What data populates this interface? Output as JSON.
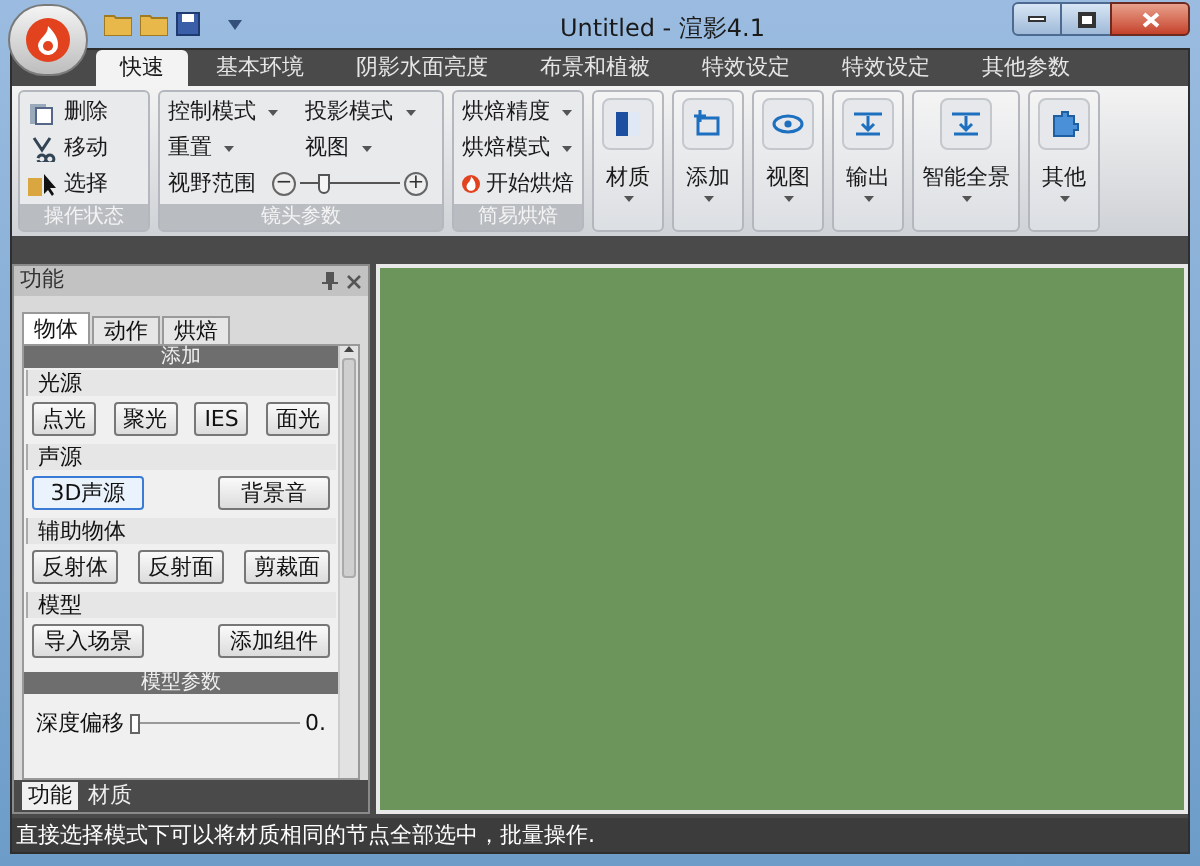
{
  "window": {
    "title": "Untitled - 渲影4.1"
  },
  "tabs": [
    {
      "label": "快速",
      "selected": true
    },
    {
      "label": "基本环境",
      "selected": false
    },
    {
      "label": "阴影水面亮度",
      "selected": false
    },
    {
      "label": "布景和植被",
      "selected": false
    },
    {
      "label": "特效设定",
      "selected": false
    },
    {
      "label": "特效设定",
      "selected": false
    },
    {
      "label": "其他参数",
      "selected": false
    }
  ],
  "ribbon": {
    "state_group": {
      "label": "操作状态",
      "items": [
        {
          "kind": "delete",
          "label": "删除"
        },
        {
          "kind": "move",
          "label": "移动"
        },
        {
          "kind": "select",
          "label": "选择"
        }
      ]
    },
    "camera_group": {
      "label": "镜头参数",
      "dropdowns": [
        "控制模式",
        "投影模式",
        "重置",
        "视图"
      ],
      "fov_label": "视野范围",
      "zoom": {
        "minus": "−",
        "plus": "+",
        "level": 0.2
      }
    },
    "bake_group": {
      "label": "简易烘焙",
      "dropdowns": [
        "烘焙精度",
        "烘焙模式"
      ],
      "start": "开始烘焙"
    },
    "large_buttons": [
      {
        "kind": "material",
        "label": "材质"
      },
      {
        "kind": "add",
        "label": "添加"
      },
      {
        "kind": "view",
        "label": "视图"
      },
      {
        "kind": "output",
        "label": "输出"
      },
      {
        "kind": "panorama",
        "label": "智能全景"
      },
      {
        "kind": "other",
        "label": "其他"
      }
    ]
  },
  "panel": {
    "title": "功能",
    "tabs": [
      {
        "label": "物体",
        "selected": true
      },
      {
        "label": "动作",
        "selected": false
      },
      {
        "label": "烘焙",
        "selected": false
      }
    ],
    "header": "添加",
    "sections": [
      {
        "label": "光源",
        "buttons": [
          {
            "label": "点光",
            "focused": false
          },
          {
            "label": "聚光",
            "focused": false
          },
          {
            "label": "IES",
            "focused": false
          },
          {
            "label": "面光",
            "focused": false
          }
        ]
      },
      {
        "label": "声源",
        "buttons": [
          {
            "label": "3D声源",
            "focused": true
          },
          {
            "label": "背景音",
            "focused": false
          }
        ]
      },
      {
        "label": "辅助物体",
        "buttons": [
          {
            "label": "反射体",
            "focused": false
          },
          {
            "label": "反射面",
            "focused": false
          },
          {
            "label": "剪裁面",
            "focused": false
          }
        ]
      },
      {
        "label": "模型",
        "buttons": [
          {
            "label": "导入场景",
            "focused": false
          },
          {
            "label": "添加组件",
            "focused": false
          }
        ]
      }
    ],
    "params_header": "模型参数",
    "depth": {
      "label": "深度偏移",
      "level": 0.0,
      "value": "0."
    },
    "bottom_tabs": [
      {
        "label": "功能",
        "selected": true
      },
      {
        "label": "材质",
        "selected": false
      }
    ]
  },
  "status_bar": "直接选择模式下可以将材质相同的节点全部选中，批量操作."
}
